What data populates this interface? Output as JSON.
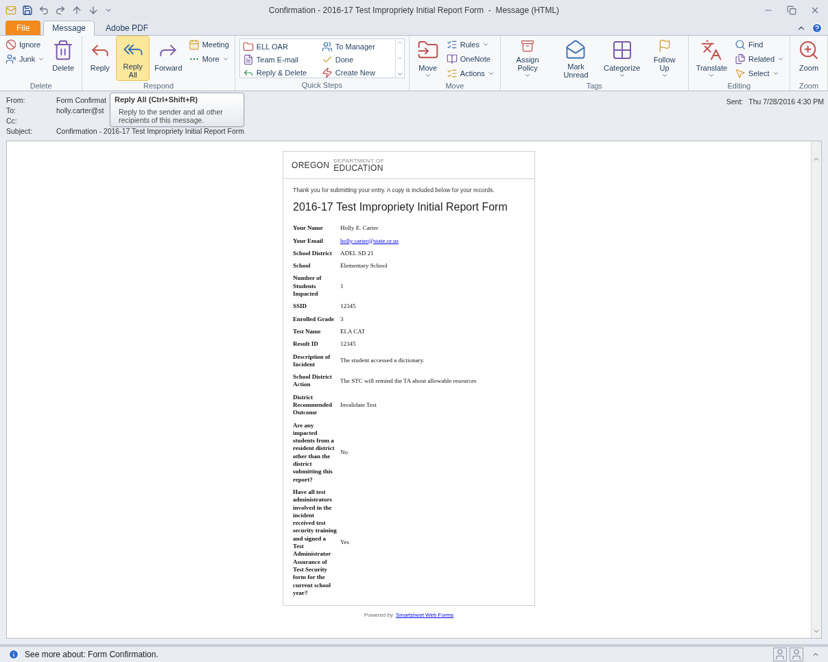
{
  "window": {
    "title": "Confirmation - 2016-17 Test Impropriety Initial Report Form  -  Message (HTML)"
  },
  "tabs": [
    {
      "label": "File",
      "kind": "file",
      "selected": false
    },
    {
      "label": "Message",
      "kind": "tab",
      "selected": true
    },
    {
      "label": "Adobe PDF",
      "kind": "tab",
      "selected": false
    }
  ],
  "ribbon": {
    "groups": [
      {
        "label": "Delete",
        "items": [
          {
            "kind": "stack",
            "items": [
              {
                "label": "Ignore",
                "dropdown": false
              },
              {
                "label": "Junk",
                "dropdown": true
              }
            ]
          },
          {
            "kind": "large",
            "label": "Delete",
            "dropdown": false,
            "selected": false
          }
        ]
      },
      {
        "label": "Respond",
        "items": [
          {
            "kind": "large",
            "label": "Reply",
            "dropdown": false,
            "selected": false
          },
          {
            "kind": "large",
            "label": "Reply All",
            "dropdown": false,
            "selected": true
          },
          {
            "kind": "large",
            "label": "Forward",
            "dropdown": false,
            "selected": false
          },
          {
            "kind": "stack",
            "items": [
              {
                "label": "Meeting",
                "dropdown": false
              },
              {
                "label": "More",
                "dropdown": true
              }
            ]
          }
        ]
      },
      {
        "label": "Quick Steps",
        "items": [
          {
            "kind": "gallery",
            "items": [
              "ELL OAR",
              "To Manager",
              "Team E-mail",
              "Done",
              "Reply & Delete",
              "Create New"
            ]
          }
        ]
      },
      {
        "label": "Move",
        "items": [
          {
            "kind": "large",
            "label": "Move",
            "dropdown": true,
            "selected": false
          },
          {
            "kind": "stack",
            "items": [
              {
                "label": "Rules",
                "dropdown": true
              },
              {
                "label": "OneNote",
                "dropdown": false
              },
              {
                "label": "Actions",
                "dropdown": true
              }
            ]
          }
        ]
      },
      {
        "label": "Tags",
        "items": [
          {
            "kind": "large",
            "label": "Assign Policy",
            "dropdown": true,
            "selected": false
          },
          {
            "kind": "large",
            "label": "Mark Unread",
            "dropdown": false,
            "selected": false
          },
          {
            "kind": "large",
            "label": "Categorize",
            "dropdown": true,
            "selected": false
          },
          {
            "kind": "large",
            "label": "Follow Up",
            "dropdown": true,
            "selected": false
          }
        ]
      },
      {
        "label": "Editing",
        "items": [
          {
            "kind": "large",
            "label": "Translate",
            "dropdown": true,
            "selected": false
          },
          {
            "kind": "stack",
            "items": [
              {
                "label": "Find",
                "dropdown": false
              },
              {
                "label": "Related",
                "dropdown": true
              },
              {
                "label": "Select",
                "dropdown": true
              }
            ]
          }
        ]
      },
      {
        "label": "Zoom",
        "items": [
          {
            "kind": "large",
            "label": "Zoom",
            "dropdown": false,
            "selected": false
          }
        ]
      }
    ]
  },
  "tooltip": {
    "title": "Reply All (Ctrl+Shift+R)",
    "text": "Reply to the sender and all other recipients of this message."
  },
  "header": {
    "fields": [
      {
        "label": "From:",
        "value": "Form Confirmat"
      },
      {
        "label": "To:",
        "value": "holly.carter@st"
      },
      {
        "label": "Cc:"
      },
      {
        "label": "Subject:",
        "value": "Confirmation - 2016-17 Test Impropriety Initial Report Form"
      }
    ],
    "sent_label": "Sent:",
    "sent": "Thu 7/28/2016 4:30 PM"
  },
  "email": {
    "logo_main": "OREGON",
    "logo_top": "DEPARTMENT OF",
    "logo_bottom": "EDUCATION",
    "intro": "Thank you for submitting your entry. A copy is included below for your records.",
    "title": "2016-17 Test Impropriety Initial Report Form",
    "fields": [
      {
        "label": "Your Name",
        "value": "Holly E. Carter",
        "kind": "text"
      },
      {
        "label": "Your Email",
        "value": "holly.carter@state.or.us",
        "kind": "link"
      },
      {
        "label": "School District",
        "value": "ADEL SD 21",
        "kind": "text"
      },
      {
        "label": "School",
        "value": "Elementary School",
        "kind": "text"
      },
      {
        "label": "Number of Students Impacted",
        "value": "1",
        "kind": "text"
      },
      {
        "label": "SSID",
        "value": "12345",
        "kind": "text"
      },
      {
        "label": "Enrolled Grade",
        "value": "3",
        "kind": "text"
      },
      {
        "label": "Test Name",
        "value": "ELA CAT",
        "kind": "text"
      },
      {
        "label": "Result ID",
        "value": "12345",
        "kind": "text"
      },
      {
        "label": "Description of Incident",
        "value": "The student accessed a dictionary.",
        "kind": "text"
      },
      {
        "label": "School District Action",
        "value": "The STC will remind the TA about allowable resources",
        "kind": "text"
      },
      {
        "label": "District Recommended Outcome",
        "value": "Invalidate Test",
        "kind": "text"
      },
      {
        "label": "Are any impacted students from a resident district other than the district submitting this report?",
        "value": "No",
        "kind": "text"
      },
      {
        "label": "Have all test administrators involved in the incident received test security training and signed a Test Administrator Assurance of Test Security form for the current school year?",
        "value": "Yes",
        "kind": "text"
      }
    ],
    "powered_by": "Powered by",
    "powered_link": "Smartsheet Web Forms"
  },
  "status_bar": {
    "text": "See more about: Form Confirmation."
  }
}
